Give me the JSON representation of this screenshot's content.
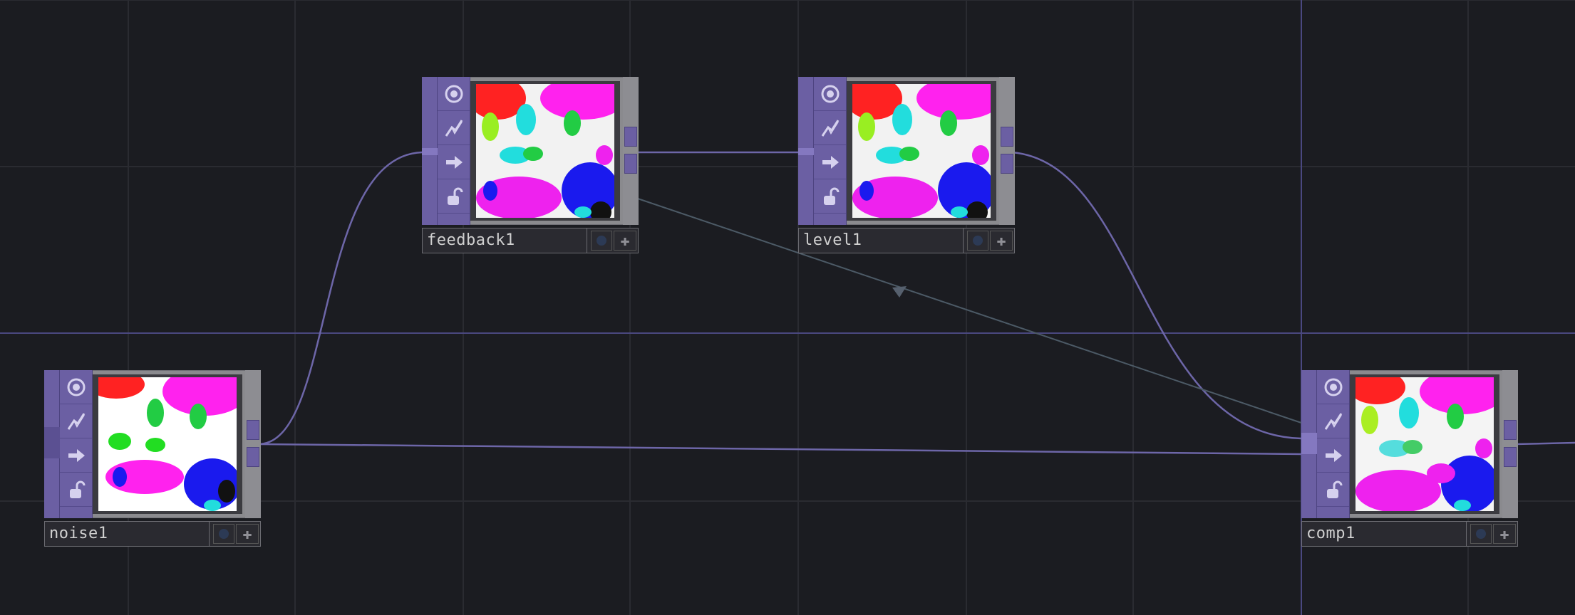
{
  "app": "TouchDesigner network editor",
  "colors": {
    "background": "#1b1c21",
    "wire": "#6d66a8",
    "feedback_wire": "#4c5a66",
    "operator_purple": "#6b5fa3"
  },
  "nodes": [
    {
      "id": "feedback1",
      "label": "feedback1",
      "icons": [
        "viewer-active-icon",
        "bypass-icon",
        "cook-icon",
        "lock-icon"
      ]
    },
    {
      "id": "level1",
      "label": "level1",
      "icons": [
        "viewer-active-icon",
        "bypass-icon",
        "cook-icon",
        "lock-icon"
      ]
    },
    {
      "id": "noise1",
      "label": "noise1",
      "icons": [
        "viewer-active-icon",
        "bypass-icon",
        "cook-icon",
        "lock-icon"
      ]
    },
    {
      "id": "comp1",
      "label": "comp1",
      "icons": [
        "viewer-active-icon",
        "bypass-icon",
        "cook-icon",
        "lock-icon"
      ]
    }
  ]
}
